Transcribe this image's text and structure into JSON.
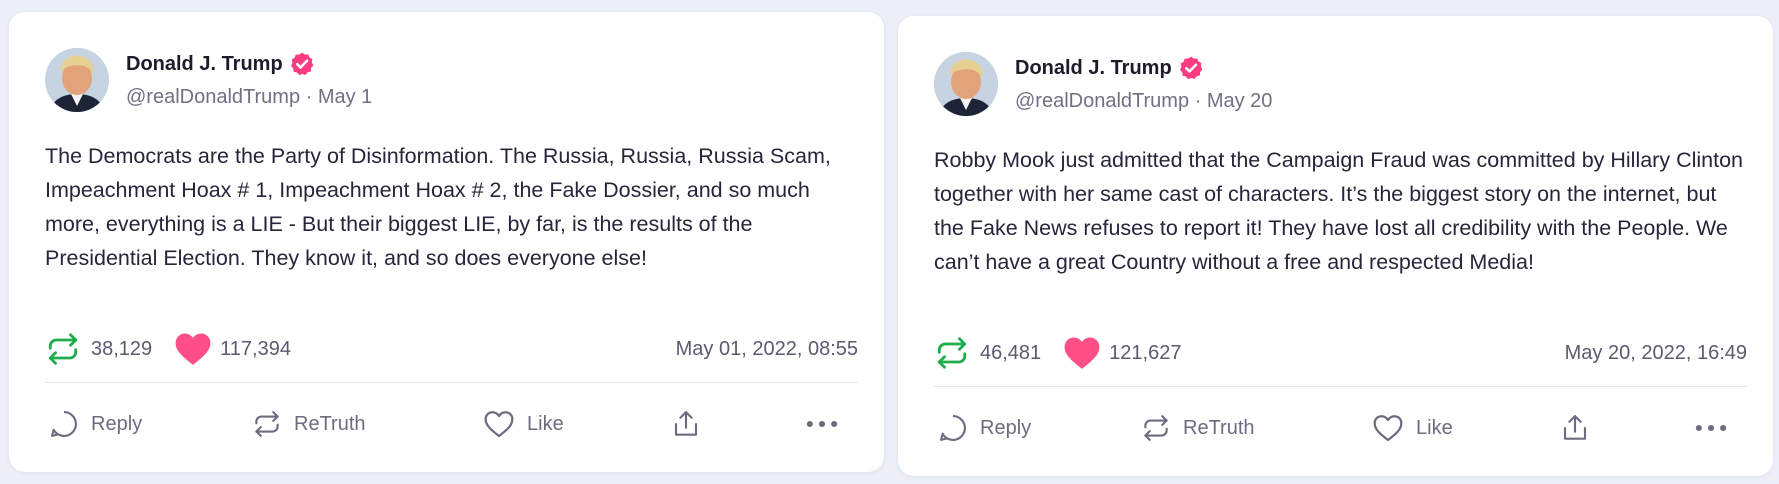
{
  "colors": {
    "accent": "#ff3b80",
    "retruth_green": "#1fad4e",
    "heart_pink": "#ff4f86",
    "muted_text": "#707084"
  },
  "actions": {
    "reply": "Reply",
    "retruth": "ReTruth",
    "like": "Like"
  },
  "posts": [
    {
      "author_name": "Donald J. Trump",
      "verified": true,
      "handle_line": "@realDonaldTrump · May 1",
      "text": "The Democrats are the Party of Disinformation. The Russia, Russia, Russia Scam, Impeachment Hoax # 1, Impeachment Hoax # 2, the Fake Dossier, and so much more, everything is a LIE - But their biggest LIE, by far, is the results of the Presidential Election. They know it, and so does everyone else!",
      "retruths": "38,129",
      "likes": "117,394",
      "timestamp": "May 01, 2022, 08:55"
    },
    {
      "author_name": "Donald J. Trump",
      "verified": true,
      "handle_line": "@realDonaldTrump · May 20",
      "text": "Robby Mook just admitted that the Campaign Fraud was committed by Hillary Clinton together with her same cast of characters. It’s the biggest story on the internet, but the Fake News refuses to report it! They have lost all credibility with the People. We can’t have a great Country without a free and respected Media!",
      "retruths": "46,481",
      "likes": "121,627",
      "timestamp": "May 20, 2022, 16:49"
    }
  ]
}
